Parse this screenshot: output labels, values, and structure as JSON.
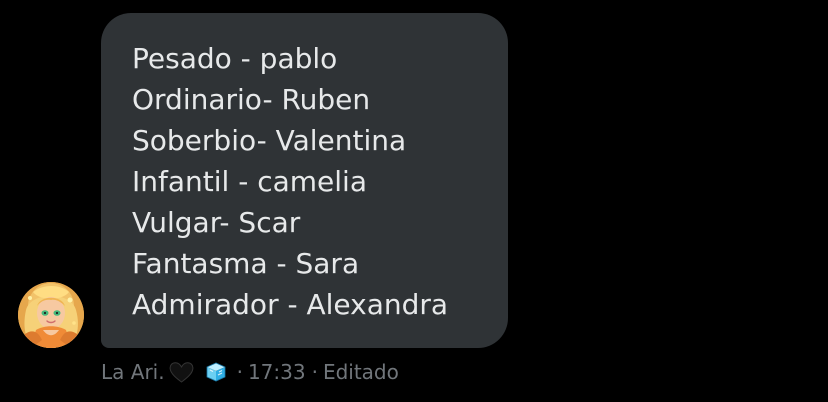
{
  "message": {
    "lines": [
      "Pesado - pablo",
      "Ordinario- Ruben",
      "Soberbio- Valentina",
      "Infantil - camelia",
      "Vulgar- Scar",
      "Fantasma - Sara",
      "Admirador - Alexandra"
    ]
  },
  "meta": {
    "sender_name": "La Ari.",
    "separator": "·",
    "time": "17:33",
    "edited_label": "Editado"
  },
  "icons": {
    "heart": "black-heart-icon",
    "ice": "ice-cube-icon",
    "avatar": "user-avatar"
  },
  "colors": {
    "background": "#000000",
    "bubble": "#2f3336",
    "text": "#e7e9ea",
    "meta": "#71767b"
  }
}
